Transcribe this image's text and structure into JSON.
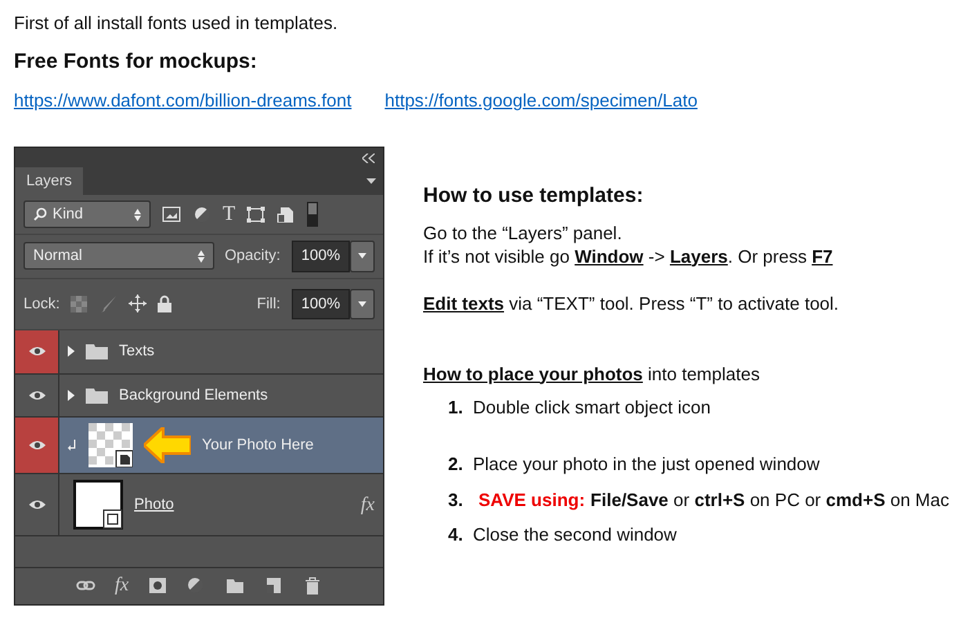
{
  "intro": "First of all install fonts used in templates.",
  "fonts_heading": "Free Fonts for mockups:",
  "font_links": [
    "https://www.dafont.com/billion-dreams.font",
    "https://fonts.google.com/specimen/Lato"
  ],
  "layers_panel": {
    "tab": {
      "label": "Layers",
      "selected": true
    },
    "filter": "Kind",
    "filter_letter": "T",
    "blend_mode": "Normal",
    "opacity_label": "Opacity:",
    "opacity": "100%",
    "lock_label": "Lock:",
    "fill_label": "Fill:",
    "fill": "100%",
    "footer_effects": "fx",
    "layers": [
      {
        "name": "Texts",
        "kind": "folder",
        "highlighted": true,
        "selected": false
      },
      {
        "name": "Background Elements",
        "kind": "folder",
        "highlighted": false,
        "selected": false
      },
      {
        "name": "Your Photo Here",
        "kind": "smart",
        "highlighted": true,
        "selected": true
      },
      {
        "name": "Photo",
        "kind": "photo",
        "highlighted": false,
        "selected": false,
        "effects": "fx"
      }
    ]
  },
  "howto": {
    "heading": "How to use templates:",
    "paragraphs": [
      "Go to the “Layers” panel.",
      "If it’s not visible go **Window** -> **Layers**. Or press **F7**",
      "**Edit texts** via “TEXT” tool. Press “T” to activate tool."
    ],
    "place_heading": "**How to place your photos** into templates",
    "steps": [
      {
        "number": "1.",
        "text": "Double click smart object icon"
      },
      {
        "number": "2.",
        "text": "Place your photo in the just opened window"
      },
      {
        "number": "3.",
        "alert": "SAVE using:",
        "text": "**File/Save** or **ctrl+S** on PC or **cmd+S** on Mac"
      },
      {
        "number": "4.",
        "text": "Close the second window"
      }
    ]
  }
}
